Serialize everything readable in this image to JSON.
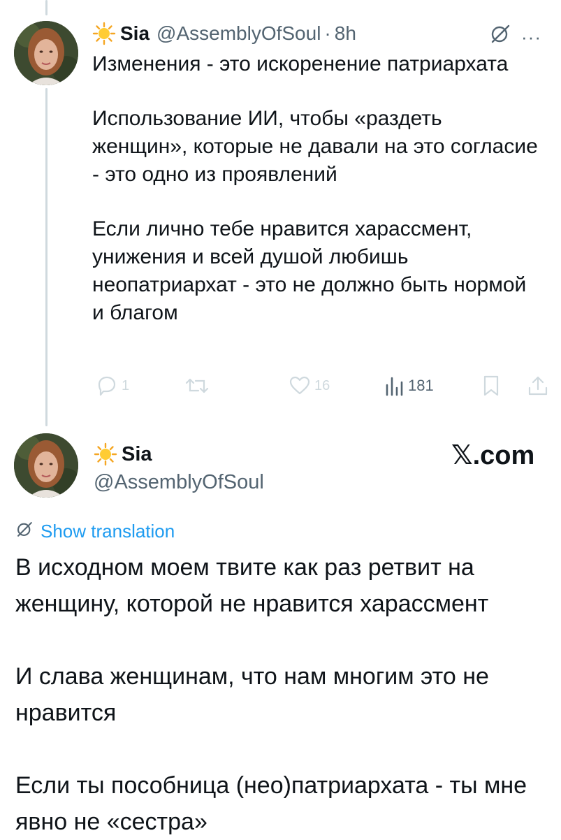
{
  "tweet1": {
    "emoji": "sun-emoji",
    "name": "Sia",
    "handle": "@AssemblyOfSoul",
    "separator": "·",
    "time": "8h",
    "more": "···",
    "paragraphs": [
      "Изменения - это искоренение патриархата",
      "Использование ИИ, чтобы «раздеть женщин», которые не давали на это согласие - это одно из проявлений",
      "Если лично тебе нравится харассмент, унижения и всей душой любишь неопатриархат - это не должно быть нормой и благом"
    ],
    "actions": {
      "replies": "1",
      "retweets": "",
      "likes": "16",
      "views": "181"
    }
  },
  "tweet2": {
    "name": "Sia",
    "handle": "@AssemblyOfSoul",
    "watermark": "𝕏.com",
    "translate_label": "Show translation",
    "paragraphs": [
      "В исходном моем твите как раз ретвит на женщину, которой не нравится харассмент",
      "И слава женщинам, что нам многим это не нравится",
      "Если ты пособница (нео)патриархата - ты мне явно не «сестра»"
    ]
  },
  "colors": {
    "text": "#0f1419",
    "muted": "#536471",
    "accent": "#1d9bf0",
    "thread_line": "#cfd9de"
  }
}
